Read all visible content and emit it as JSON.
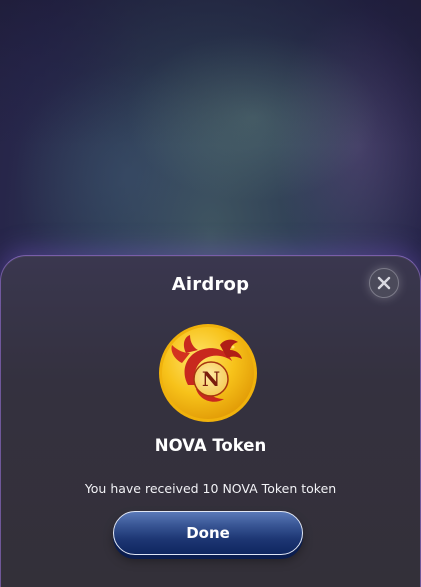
{
  "dialog": {
    "title": "Airdrop",
    "close_icon": "close-icon"
  },
  "token": {
    "name": "NOVA Token",
    "logo_letter": "N",
    "logo_icon": "nova-token-logo",
    "message": "You have received 10 NOVA Token token"
  },
  "actions": {
    "done_label": "Done"
  },
  "colors": {
    "accent_border": "#a078e6",
    "button_top": "#5a79b8",
    "button_bottom": "#0f2660",
    "coin_gold": "#f5c518",
    "dragon_red": "#c8281e"
  }
}
